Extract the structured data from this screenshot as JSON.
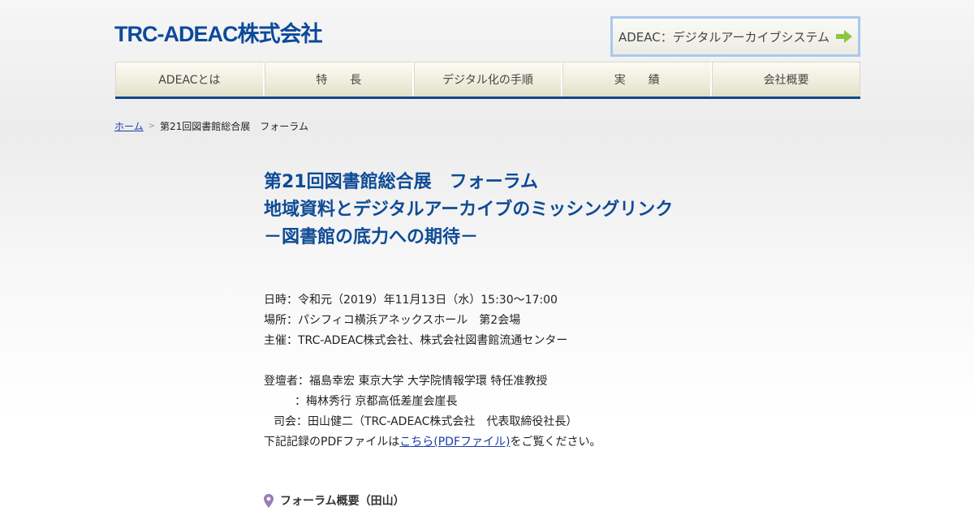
{
  "header": {
    "logo_text": "TRC-ADEAC株式会社",
    "system_button_label": "ADEAC：デジタルアーカイブシステム",
    "brand_color": "#0c4a9a",
    "accent_color": "#8cc63f"
  },
  "nav": {
    "items": [
      {
        "label": "ADEACとは"
      },
      {
        "label": "特　　長"
      },
      {
        "label": "デジタル化の手順"
      },
      {
        "label": "実　　績"
      },
      {
        "label": "会社概要"
      }
    ]
  },
  "breadcrumb": {
    "home": "ホーム",
    "current": "第21回図書館総合展　フォーラム"
  },
  "page": {
    "title_lines": [
      "第21回図書館総合展　フォーラム",
      "地域資料とデジタルアーカイブのミッシングリンク",
      "－図書館の底力への期待－"
    ],
    "datetime": "日時：令和元（2019）年11月13日（水）15:30～17:00",
    "place": "場所：パシフィコ横浜アネックスホール　第2会場",
    "host": "主催：TRC-ADEAC株式会社、株式会社図書館流通センター",
    "speaker1": "登壇者：福島幸宏 東京大学 大学院情報学環 特任准教授",
    "speaker2": "：梅林秀行 京都高低差崖会崖長",
    "moderator": "司会：田山健二（TRC-ADEAC株式会社　代表取締役社長）",
    "record_prefix": "下記記録のPDFファイルは",
    "record_link": "こちら(PDFファイル)",
    "record_suffix": "をご覧ください。",
    "section_heading": "フォーラム概要（田山）",
    "section_icon": "map-pin-icon",
    "section_icon_color": "#9a7bb8"
  }
}
